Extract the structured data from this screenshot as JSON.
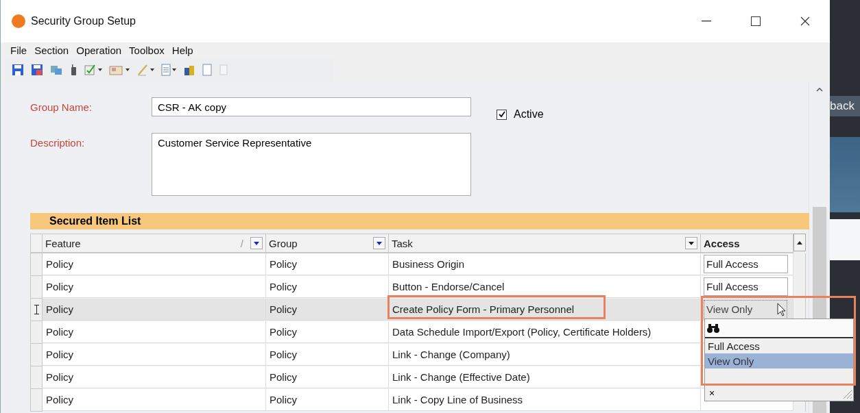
{
  "window": {
    "title": "Security Group Setup"
  },
  "menu": [
    "File",
    "Section",
    "Operation",
    "Toolbox",
    "Help"
  ],
  "form": {
    "group_name": {
      "label": "Group Name:",
      "value": "CSR - AK copy"
    },
    "description": {
      "label": "Description:",
      "value": "Customer Service Representative"
    },
    "active": {
      "label": "Active",
      "checked": true
    }
  },
  "grid": {
    "title": "Secured Item List",
    "columns": [
      {
        "label": "Feature",
        "filter": true,
        "color": "#1428d8",
        "sort_mark": "/",
        "bold": false
      },
      {
        "label": "Group",
        "filter": true,
        "color": "#1428d8",
        "bold": false
      },
      {
        "label": "Task",
        "filter": true,
        "color": "#222222",
        "bold": false
      },
      {
        "label": "Access",
        "filter": false,
        "bold": true
      }
    ],
    "rows": [
      {
        "kind": "box",
        "feature": "Policy",
        "group": "Policy",
        "task": "Business Origin",
        "access": "Full Access",
        "current": false,
        "annotated": false
      },
      {
        "kind": "box",
        "feature": "Policy",
        "group": "Policy",
        "task": "Button - Endorse/Cancel",
        "access": "Full Access",
        "current": false,
        "annotated": false
      },
      {
        "kind": "editor",
        "feature": "Policy",
        "group": "Policy",
        "task": "Create Policy Form - Primary Personnel",
        "access": "View Only",
        "current": true,
        "annotated": true
      },
      {
        "kind": "hidden",
        "feature": "Policy",
        "group": "Policy",
        "task": "Data Schedule Import/Export (Policy, Certificate Holders)",
        "current": false,
        "annotated": false
      },
      {
        "kind": "hidden",
        "feature": "Policy",
        "group": "Policy",
        "task": "Link - Change (Company)",
        "current": false,
        "annotated": false
      },
      {
        "kind": "hidden",
        "feature": "Policy",
        "group": "Policy",
        "task": "Link - Change (Effective Date)",
        "current": false,
        "annotated": false
      },
      {
        "kind": "hidden",
        "feature": "Policy",
        "group": "Policy",
        "task": "Link - Copy Line of Business",
        "current": false,
        "annotated": false
      }
    ],
    "dropdown": {
      "annotated": true,
      "close": "×",
      "options": [
        {
          "label": "Full Access",
          "selected": false
        },
        {
          "label": "View Only",
          "selected": true
        }
      ]
    }
  },
  "background_app": {
    "button": "back"
  }
}
